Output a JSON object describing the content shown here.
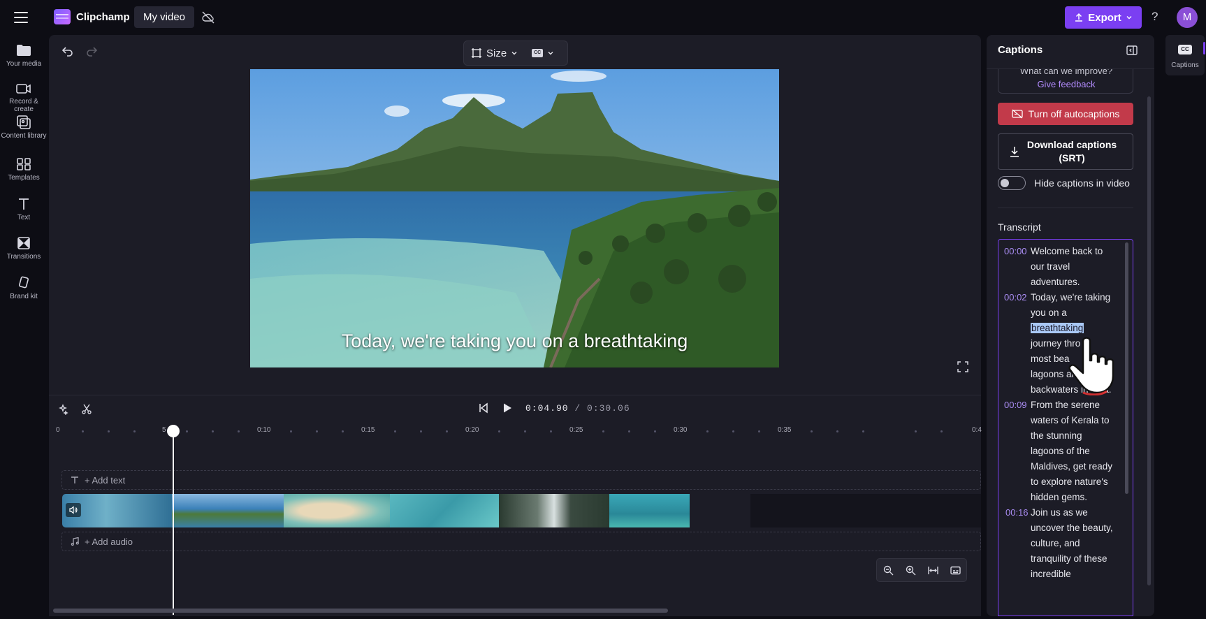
{
  "app": {
    "brand": "Clipchamp",
    "project_name": "My video",
    "export_label": "Export",
    "help": "?",
    "avatar_initial": "M"
  },
  "leftnav": [
    {
      "label": "Your media",
      "icon": "folder-icon"
    },
    {
      "label": "Record & create",
      "icon": "camera-icon"
    },
    {
      "label": "Content library",
      "icon": "content-library-icon"
    },
    {
      "label": "Templates",
      "icon": "templates-icon"
    },
    {
      "label": "Text",
      "icon": "text-icon"
    },
    {
      "label": "Transitions",
      "icon": "transitions-icon"
    },
    {
      "label": "Brand kit",
      "icon": "brand-kit-icon"
    }
  ],
  "preview": {
    "size_label": "Size",
    "cc_label": "CC",
    "caption_text": "Today, we're taking you on a breathtaking"
  },
  "timeline": {
    "current_time": "0:04.90",
    "total_time": "/ 0:30.06",
    "ruler_labels": [
      "0",
      "5",
      "0:10",
      "0:15",
      "0:20",
      "0:25",
      "0:30",
      "0:35",
      "0:4"
    ],
    "add_text": "+ Add text",
    "add_audio": "+ Add audio"
  },
  "captions_panel": {
    "title": "Captions",
    "feedback_question": "What can we improve?",
    "feedback_link": "Give feedback",
    "turn_off_label": "Turn off autocaptions",
    "download_label_1": "Download captions",
    "download_label_2": "(SRT)",
    "hide_toggle_label": "Hide captions in video",
    "transcript_label": "Transcript",
    "segments": [
      {
        "ts": "00:00",
        "lines": [
          "Welcome back to",
          "our travel",
          "adventures."
        ]
      },
      {
        "ts": "00:02",
        "lines": [
          "Today, we're taking",
          "you on a",
          "breathtaking",
          "journey thro",
          "most bea",
          "lagoons and",
          "backwaters in Asia."
        ]
      },
      {
        "ts": "00:09",
        "lines": [
          "From the serene",
          "waters of Kerala to",
          "the stunning",
          "lagoons of the",
          "Maldives, get ready",
          "to explore nature's",
          "hidden gems."
        ]
      },
      {
        "ts": "00:16",
        "lines": [
          "Join us as we",
          "uncover the beauty,",
          "culture, and",
          "tranquility of these",
          "incredible"
        ]
      }
    ]
  },
  "right_rail": {
    "cc_badge": "CC",
    "label": "Captions"
  },
  "colors": {
    "accent": "#7b3ff2",
    "danger": "#c23a4a",
    "panel": "#1c1c26",
    "background": "#0d0d14"
  }
}
